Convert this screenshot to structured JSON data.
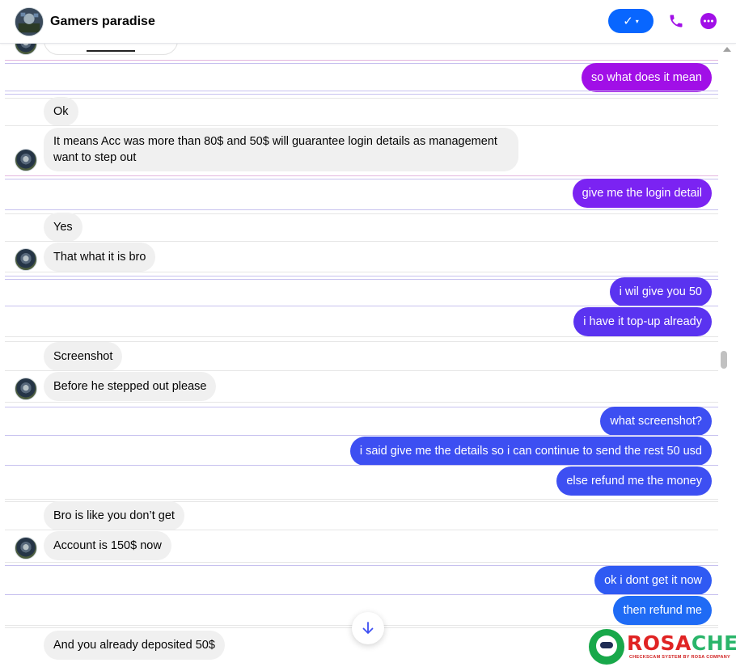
{
  "header": {
    "title": "Gamers paradise",
    "check_label": "✓",
    "caret": "▾"
  },
  "messages": [
    {
      "id": "m1",
      "side": "out",
      "text": "so what does it mean"
    },
    {
      "id": "m2",
      "side": "in",
      "text": "Ok"
    },
    {
      "id": "m3",
      "side": "in",
      "text": "It means Acc was more than 80$ and 50$ will guarantee login details as management want to step out"
    },
    {
      "id": "m4",
      "side": "out",
      "text": "give me the login detail"
    },
    {
      "id": "m5",
      "side": "in",
      "text": "Yes"
    },
    {
      "id": "m6",
      "side": "in",
      "text": "That what it is bro"
    },
    {
      "id": "m7",
      "side": "out",
      "text": "i wil give you 50"
    },
    {
      "id": "m8",
      "side": "out",
      "text": "i have it top-up already"
    },
    {
      "id": "m9",
      "side": "in",
      "text": "Screenshot"
    },
    {
      "id": "m10",
      "side": "in",
      "text": "Before he stepped out please"
    },
    {
      "id": "m11",
      "side": "out",
      "text": "what screenshot?"
    },
    {
      "id": "m12",
      "side": "out",
      "text": "i said give me the details so i can continue to send the rest 50 usd"
    },
    {
      "id": "m13",
      "side": "out",
      "text": "else refund me the money"
    },
    {
      "id": "m14",
      "side": "in",
      "text": "Bro is like you don’t get"
    },
    {
      "id": "m15",
      "side": "in",
      "text": "Account is 150$ now"
    },
    {
      "id": "m16",
      "side": "out",
      "text": "ok i dont get it now"
    },
    {
      "id": "m17",
      "side": "out",
      "text": "then refund me"
    },
    {
      "id": "m18",
      "side": "in",
      "text": "And you already deposited 50$"
    }
  ],
  "watermark": {
    "brand_part1": "ROSA",
    "brand_part2": "CHECK",
    "tagline": "CHECKSCAM SYSTEM BY ROSA COMPANY"
  },
  "colors": {
    "accent": "#0866ff",
    "call_icon": "#a10fe7",
    "more_icon": "#a10fe7"
  },
  "icons": [
    "verified-check-icon",
    "phone-icon",
    "more-options-icon",
    "arrow-down-icon",
    "scroll-up-arrow-icon"
  ]
}
